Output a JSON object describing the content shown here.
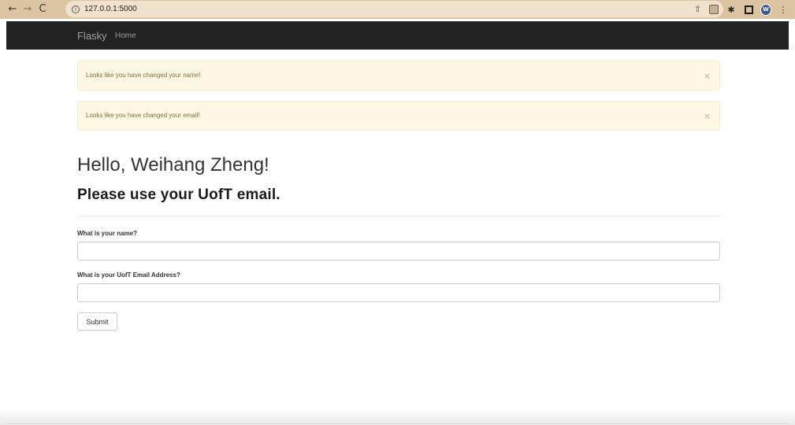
{
  "browser": {
    "url": "127.0.0.1:5000",
    "avatar_letter": "W",
    "colors": {
      "toolbar": "#dcc3a2",
      "omnibox": "#f1e2cd"
    }
  },
  "navbar": {
    "brand": "Flasky",
    "links": [
      {
        "label": "Home"
      }
    ],
    "colors": {
      "background": "#222222",
      "text": "#9d9d9d"
    }
  },
  "alerts": [
    {
      "text": "Looks like you have changed your name!",
      "close": "×"
    },
    {
      "text": "Looks like you have changed your email!",
      "close": "×"
    }
  ],
  "page": {
    "greeting": "Hello, Weihang Zheng!",
    "subtitle": "Please use your UofT email."
  },
  "form": {
    "name_label": "What is your name?",
    "name_value": "",
    "email_label": "What is your UofT Email Address?",
    "email_value": "",
    "submit_label": "Submit"
  },
  "colors": {
    "alert_bg": "#fcf8e3",
    "alert_text": "#8a6d3b",
    "alert_border": "#faebcc"
  }
}
